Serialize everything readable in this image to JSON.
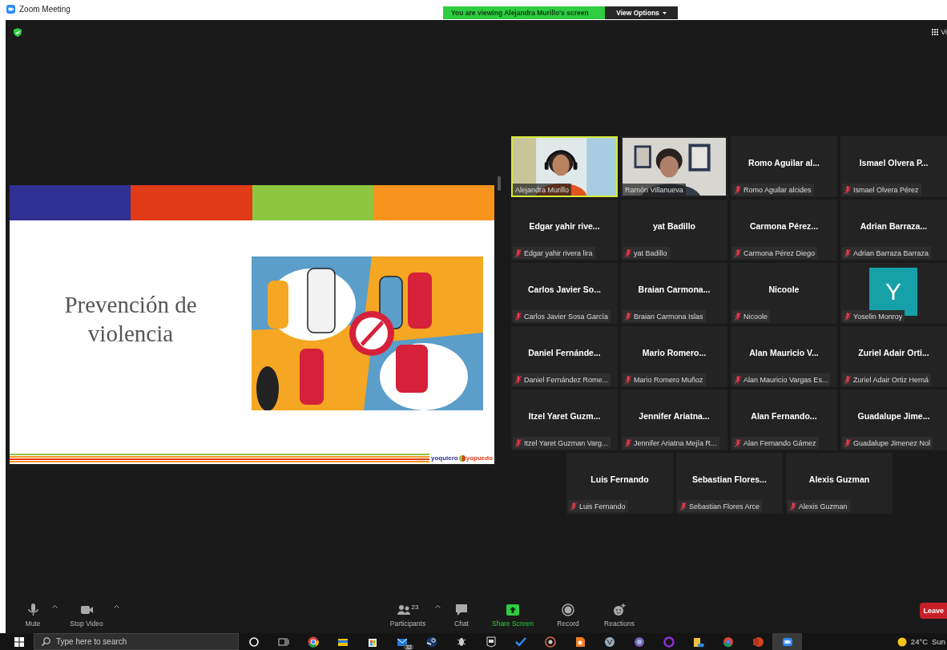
{
  "title_bar": {
    "title": "Zoom Meeting"
  },
  "share_banner": {
    "text": "You are viewing Alejandra Murillo's screen",
    "options": "View Options"
  },
  "view_button": {
    "label": "Vi"
  },
  "slide": {
    "title": "Prevención de violencia",
    "logo": [
      "yoquiero",
      "yopuedo"
    ]
  },
  "gallery": {
    "rows": [
      [
        {
          "kind": "video",
          "label": "Alejandra Murillo",
          "muted": false,
          "active": true
        },
        {
          "kind": "video",
          "label": "Ramón Villanueva",
          "muted": false,
          "active": false
        },
        {
          "kind": "name",
          "title": "Romo Aguilar al...",
          "label": "Romo Aguilar alcides",
          "muted": true,
          "active": false
        },
        {
          "kind": "name",
          "title": "Ismael Olvera P...",
          "label": "Ismael Olvera Pérez",
          "muted": true,
          "active": false
        }
      ],
      [
        {
          "kind": "name",
          "title": "Edgar yahir rive...",
          "label": "Edgar yahir rivera lira",
          "muted": true,
          "active": false
        },
        {
          "kind": "name",
          "title": "yat Badillo",
          "label": "yat Badillo",
          "muted": true,
          "active": false
        },
        {
          "kind": "name",
          "title": "Carmona Pérez...",
          "label": "Carmona Pérez Diego",
          "muted": true,
          "active": false
        },
        {
          "kind": "name",
          "title": "Adrian Barraza...",
          "label": "Adrian Barraza Barraza",
          "muted": true,
          "active": false
        }
      ],
      [
        {
          "kind": "name",
          "title": "Carlos Javier So...",
          "label": "Carlos Javier Sosa García",
          "muted": true,
          "active": false
        },
        {
          "kind": "name",
          "title": "Braian Carmona...",
          "label": "Braian Carmona Islas",
          "muted": true,
          "active": false
        },
        {
          "kind": "name",
          "title": "Nicoole",
          "label": "Nicoole",
          "muted": true,
          "active": false
        },
        {
          "kind": "avatar",
          "initial": "Y",
          "label": "Yoselin Monroy",
          "muted": true,
          "active": false
        }
      ],
      [
        {
          "kind": "name",
          "title": "Daniel Fernánde...",
          "label": "Daniel Fernández Rome...",
          "muted": true,
          "active": false
        },
        {
          "kind": "name",
          "title": "Mario Romero...",
          "label": "Mario Romero Muñoz",
          "muted": true,
          "active": false
        },
        {
          "kind": "name",
          "title": "Alan Mauricio V...",
          "label": "Alan Mauricio Vargas Es...",
          "muted": true,
          "active": false
        },
        {
          "kind": "name",
          "title": "Zuriel Adair Orti...",
          "label": "Zuriel Adair Ortiz Herná",
          "muted": true,
          "active": false
        }
      ],
      [
        {
          "kind": "name",
          "title": "Itzel Yaret Guzm...",
          "label": "Itzel Yaret Guzman Varg...",
          "muted": true,
          "active": false
        },
        {
          "kind": "name",
          "title": "Jennifer Ariatna...",
          "label": "Jennifer Ariatna Mejía R...",
          "muted": true,
          "active": false
        },
        {
          "kind": "name",
          "title": "Alan Fernando...",
          "label": "Alan Fernando Gámez",
          "muted": true,
          "active": false
        },
        {
          "kind": "name",
          "title": "Guadalupe Jime...",
          "label": "Guadalupe Jimenez Nol",
          "muted": true,
          "active": false
        }
      ],
      [
        {
          "kind": "name",
          "title": "Luis Fernando",
          "label": "Luis Fernando",
          "muted": true,
          "active": false
        },
        {
          "kind": "name",
          "title": "Sebastian Flores...",
          "label": "Sebastian Flores Arce",
          "muted": true,
          "active": false
        },
        {
          "kind": "name",
          "title": "Alexis Guzman",
          "label": "Alexis Guzman",
          "muted": true,
          "active": false
        }
      ]
    ]
  },
  "toolbar": {
    "items": [
      {
        "label": "Mute",
        "caret": true,
        "highlighted": false
      },
      {
        "label": "Stop Video",
        "caret": true,
        "highlighted": false
      },
      {
        "label": "Participants",
        "count": "23",
        "caret": true,
        "highlighted": false
      },
      {
        "label": "Chat",
        "caret": false,
        "highlighted": false
      },
      {
        "label": "Share Screen",
        "caret": false,
        "highlighted": true
      },
      {
        "label": "Record",
        "caret": false,
        "highlighted": false
      },
      {
        "label": "Reactions",
        "caret": false,
        "highlighted": false
      }
    ],
    "leave": "Leave"
  },
  "taskbar": {
    "search": {
      "placeholder": "Type here to search"
    },
    "apps": [
      {
        "active": false
      },
      {
        "active": false
      },
      {
        "active": false
      },
      {
        "active": false
      },
      {
        "active": false
      },
      {
        "active": false,
        "badge": "32"
      },
      {
        "active": false
      },
      {
        "active": false
      },
      {
        "active": false
      },
      {
        "active": false
      },
      {
        "active": false
      },
      {
        "active": false
      },
      {
        "active": false
      },
      {
        "active": false
      },
      {
        "active": false
      },
      {
        "active": false
      },
      {
        "active": false
      },
      {
        "active": false
      },
      {
        "active": true
      }
    ],
    "weather": {
      "temperature": "24°C",
      "condition": "Sun"
    }
  }
}
